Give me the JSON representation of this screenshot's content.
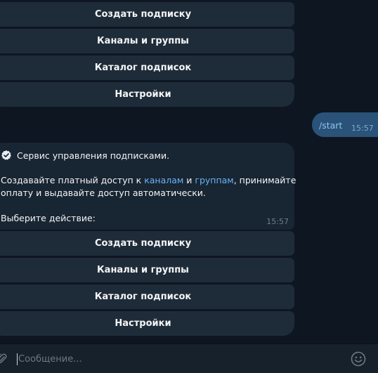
{
  "top_keyboard": {
    "buttons": [
      {
        "label": "Создать подписку"
      },
      {
        "label": "Каналы и группы"
      },
      {
        "label": "Каталог подписок"
      },
      {
        "label": "Настройки"
      }
    ]
  },
  "outgoing_message": {
    "text": "/start",
    "time": "15:57"
  },
  "incoming_message": {
    "line1": "Сервис управления подписками.",
    "line2_prefix": "Создавайте платный доступ к ",
    "link_channels": "каналам",
    "line2_and": " и ",
    "link_groups": "группам",
    "line2_suffix": ", принимайте",
    "line3": "оплату и выдавайте доступ автоматически.",
    "line4": "Выберите действие:",
    "time": "15:57",
    "icon": "verified-check-icon"
  },
  "bottom_keyboard": {
    "buttons": [
      {
        "label": "Создать подписку"
      },
      {
        "label": "Каналы и группы"
      },
      {
        "label": "Каталог подписок"
      },
      {
        "label": "Настройки"
      }
    ]
  },
  "composer": {
    "placeholder": "Сообщение...",
    "value": "",
    "attach_icon": "paperclip-icon",
    "emoji_icon": "emoji-icon"
  },
  "colors": {
    "background": "#0e1621",
    "button_bg": "#1e2c3a",
    "incoming_bg": "#182533",
    "outgoing_bg": "#2b5278",
    "link": "#6ab3f3",
    "composer_bg": "#17212b"
  }
}
